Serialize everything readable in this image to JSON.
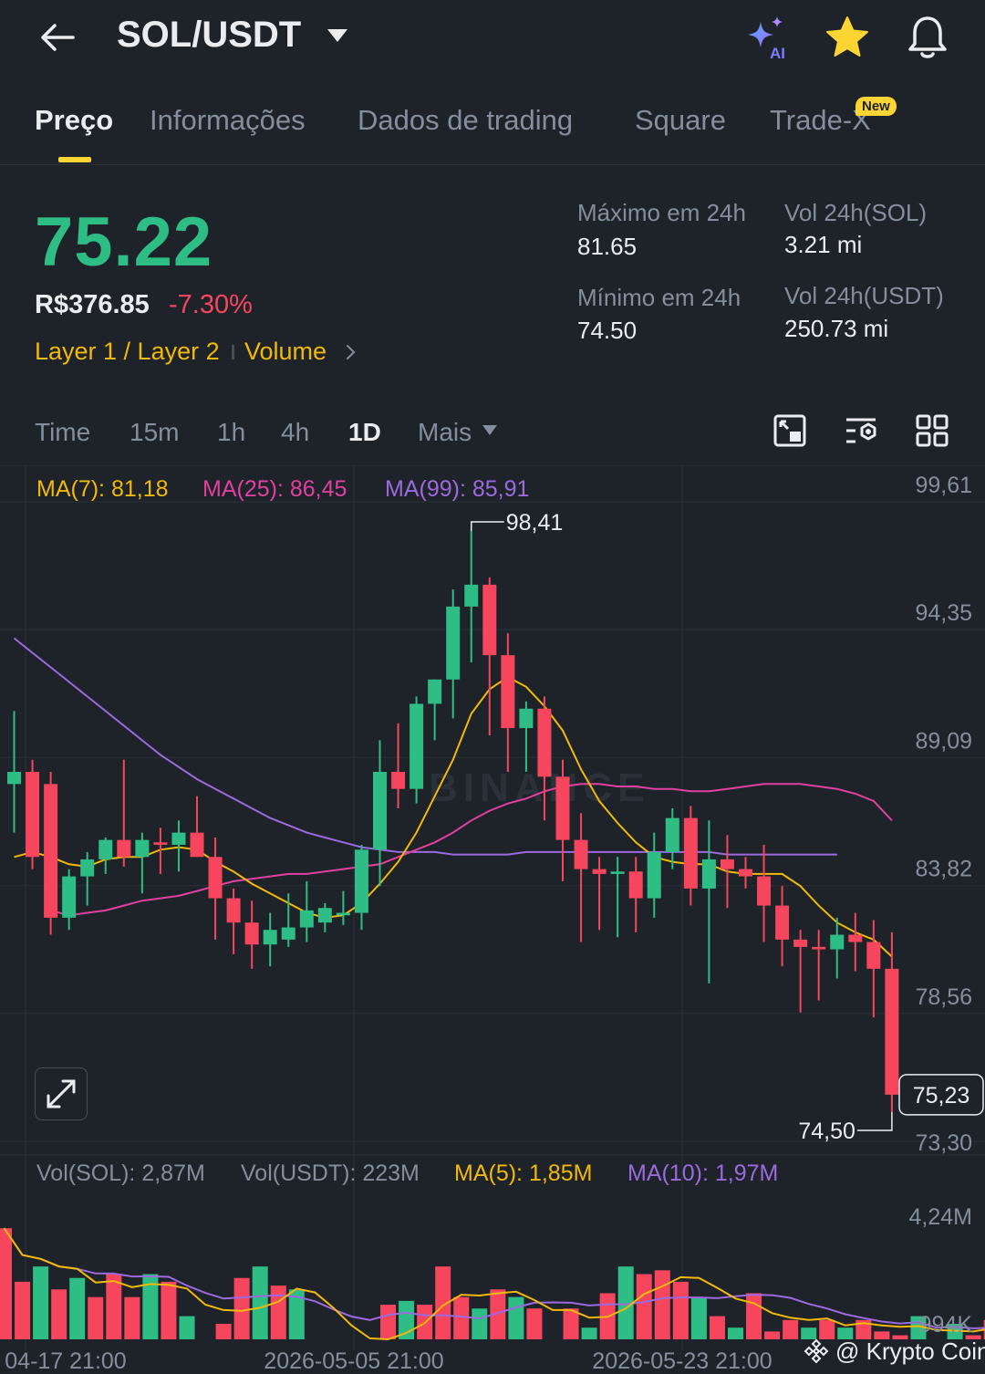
{
  "header": {
    "pair": "SOL/USDT",
    "ai_label": "AI"
  },
  "tabs": [
    {
      "label": "Preço",
      "active": true
    },
    {
      "label": "Informações"
    },
    {
      "label": "Dados de trading"
    },
    {
      "label": "Square"
    },
    {
      "label": "Trade-X",
      "badge": "New"
    }
  ],
  "ticker": {
    "last_price": "75.22",
    "fiat_price": "R$376.85",
    "change": "-7.30%",
    "tag1": "Layer 1 / Layer 2",
    "tag2": "Volume",
    "high_label": "Máximo em 24h",
    "high_value": "81.65",
    "low_label": "Mínimo em 24h",
    "low_value": "74.50",
    "vol_base_label": "Vol 24h(SOL)",
    "vol_base_value": "3.21 mi",
    "vol_quote_label": "Vol 24h(USDT)",
    "vol_quote_value": "250.73 mi"
  },
  "timeframes": [
    {
      "label": "Time"
    },
    {
      "label": "15m"
    },
    {
      "label": "1h"
    },
    {
      "label": "4h"
    },
    {
      "label": "1D",
      "active": true
    },
    {
      "label": "Mais"
    }
  ],
  "colors": {
    "up": "#2ebd85",
    "down": "#f6465d",
    "ma7": "#f0b90b",
    "ma25": "#e040a0",
    "ma99": "#9c6ade",
    "accent": "#fcd535"
  },
  "chart_data": {
    "type": "candlestick",
    "interval": "1D",
    "ma_legend": {
      "ma7": "MA(7): 81,18",
      "ma25": "MA(25): 86,45",
      "ma99": "MA(99): 85,91"
    },
    "y_ticks": [
      "99,61",
      "94,35",
      "89,09",
      "83,82",
      "78,56",
      "73,30"
    ],
    "ylim": [
      73.3,
      99.61
    ],
    "x_ticks": [
      "04-17 21:00",
      "2026-05-05 21:00",
      "2026-05-23 21:00"
    ],
    "high_marker": "98,41",
    "low_marker": "74,50",
    "current_price": "75,23",
    "candles": [
      {
        "o": 88.0,
        "h": 91.0,
        "l": 86.0,
        "c": 88.5
      },
      {
        "o": 88.5,
        "h": 89.0,
        "l": 84.5,
        "c": 85.0
      },
      {
        "o": 88.0,
        "h": 88.5,
        "l": 81.8,
        "c": 82.5
      },
      {
        "o": 82.5,
        "h": 84.5,
        "l": 82.0,
        "c": 84.2
      },
      {
        "o": 84.2,
        "h": 85.2,
        "l": 83.0,
        "c": 84.9
      },
      {
        "o": 84.9,
        "h": 85.8,
        "l": 84.3,
        "c": 85.7
      },
      {
        "o": 85.7,
        "h": 89.0,
        "l": 84.6,
        "c": 85.0
      },
      {
        "o": 85.0,
        "h": 86.0,
        "l": 83.5,
        "c": 85.7
      },
      {
        "o": 85.6,
        "h": 86.2,
        "l": 84.3,
        "c": 85.5
      },
      {
        "o": 85.5,
        "h": 86.5,
        "l": 84.4,
        "c": 86.0
      },
      {
        "o": 86.0,
        "h": 87.5,
        "l": 85.0,
        "c": 85.0
      },
      {
        "o": 85.0,
        "h": 85.8,
        "l": 81.6,
        "c": 83.3
      },
      {
        "o": 83.3,
        "h": 83.7,
        "l": 81.0,
        "c": 82.3
      },
      {
        "o": 82.3,
        "h": 83.2,
        "l": 80.4,
        "c": 81.4
      },
      {
        "o": 81.4,
        "h": 82.7,
        "l": 80.5,
        "c": 82.0
      },
      {
        "o": 81.6,
        "h": 83.5,
        "l": 81.3,
        "c": 82.1
      },
      {
        "o": 82.1,
        "h": 84.0,
        "l": 81.5,
        "c": 82.8
      },
      {
        "o": 82.3,
        "h": 83.1,
        "l": 81.9,
        "c": 82.9
      },
      {
        "o": 82.6,
        "h": 83.6,
        "l": 82.2,
        "c": 82.7
      },
      {
        "o": 82.7,
        "h": 85.5,
        "l": 82.0,
        "c": 85.3
      },
      {
        "o": 85.3,
        "h": 89.8,
        "l": 83.8,
        "c": 88.5
      },
      {
        "o": 88.5,
        "h": 90.5,
        "l": 87.0,
        "c": 87.8
      },
      {
        "o": 87.8,
        "h": 91.6,
        "l": 87.2,
        "c": 91.3
      },
      {
        "o": 91.3,
        "h": 92.3,
        "l": 89.8,
        "c": 92.3
      },
      {
        "o": 92.3,
        "h": 96.0,
        "l": 90.7,
        "c": 95.3
      },
      {
        "o": 95.3,
        "h": 98.41,
        "l": 93.0,
        "c": 96.2
      },
      {
        "o": 96.2,
        "h": 96.5,
        "l": 90.0,
        "c": 93.3
      },
      {
        "o": 93.3,
        "h": 94.2,
        "l": 88.5,
        "c": 90.3
      },
      {
        "o": 90.3,
        "h": 91.4,
        "l": 88.5,
        "c": 91.1
      },
      {
        "o": 91.1,
        "h": 91.6,
        "l": 86.5,
        "c": 88.3
      },
      {
        "o": 88.3,
        "h": 89.0,
        "l": 84.0,
        "c": 85.7
      },
      {
        "o": 85.7,
        "h": 86.8,
        "l": 81.5,
        "c": 84.5
      },
      {
        "o": 84.5,
        "h": 85.0,
        "l": 82.0,
        "c": 84.3
      },
      {
        "o": 84.3,
        "h": 85.0,
        "l": 81.7,
        "c": 84.4
      },
      {
        "o": 84.4,
        "h": 85.0,
        "l": 81.9,
        "c": 83.3
      },
      {
        "o": 83.3,
        "h": 86.0,
        "l": 82.5,
        "c": 85.2
      },
      {
        "o": 85.2,
        "h": 87.0,
        "l": 84.5,
        "c": 86.6
      },
      {
        "o": 86.6,
        "h": 87.1,
        "l": 83.0,
        "c": 83.7
      },
      {
        "o": 83.7,
        "h": 86.5,
        "l": 79.8,
        "c": 84.9
      },
      {
        "o": 84.9,
        "h": 85.9,
        "l": 82.9,
        "c": 84.5
      },
      {
        "o": 84.5,
        "h": 85.0,
        "l": 83.7,
        "c": 84.2
      },
      {
        "o": 84.2,
        "h": 85.5,
        "l": 81.5,
        "c": 83.0
      },
      {
        "o": 83.0,
        "h": 83.8,
        "l": 80.5,
        "c": 81.6
      },
      {
        "o": 81.6,
        "h": 82.0,
        "l": 78.6,
        "c": 81.3
      },
      {
        "o": 81.3,
        "h": 82.0,
        "l": 79.1,
        "c": 81.2
      },
      {
        "o": 81.2,
        "h": 82.5,
        "l": 80.0,
        "c": 81.8
      },
      {
        "o": 81.8,
        "h": 82.7,
        "l": 80.3,
        "c": 81.5
      },
      {
        "o": 81.5,
        "h": 82.4,
        "l": 78.4,
        "c": 80.4
      },
      {
        "o": 80.4,
        "h": 81.9,
        "l": 74.5,
        "c": 75.22
      }
    ],
    "ma7": [
      85.0,
      85.2,
      85.0,
      84.7,
      84.6,
      84.9,
      85.0,
      85.0,
      85.3,
      85.4,
      85.3,
      84.8,
      84.4,
      83.9,
      83.5,
      83.1,
      82.7,
      82.5,
      82.6,
      83.1,
      83.9,
      84.8,
      86.0,
      87.5,
      89.0,
      90.9,
      91.9,
      92.4,
      92.0,
      91.2,
      90.2,
      88.6,
      87.3,
      86.4,
      85.6,
      85.0,
      84.8,
      84.7,
      84.7,
      84.4,
      84.3,
      84.3,
      84.3,
      83.8,
      83.0,
      82.3,
      81.9,
      81.6,
      80.9
    ],
    "ma25": [
      82.8,
      82.6,
      82.7,
      82.8,
      83.0,
      83.2,
      83.3,
      83.4,
      83.6,
      83.8,
      84.0,
      84.1,
      84.2,
      84.3,
      84.3,
      84.4,
      84.5,
      84.6,
      84.7,
      85.0,
      85.3,
      85.6,
      86.0,
      86.5,
      86.9,
      87.2,
      87.4,
      87.7,
      87.9,
      88.0,
      88.0,
      87.9,
      87.9,
      87.8,
      87.8,
      87.7,
      87.7,
      87.8,
      87.9,
      88.0,
      88.0,
      88.0,
      87.9,
      87.8,
      87.6,
      87.3,
      86.5
    ],
    "ma99": [
      94.0,
      93.4,
      92.8,
      92.2,
      91.6,
      91.0,
      90.4,
      89.8,
      89.2,
      88.7,
      88.2,
      87.8,
      87.4,
      87.0,
      86.6,
      86.3,
      86.0,
      85.8,
      85.6,
      85.4,
      85.3,
      85.2,
      85.2,
      85.2,
      85.1,
      85.1,
      85.1,
      85.1,
      85.2,
      85.2,
      85.2,
      85.2,
      85.2,
      85.2,
      85.2,
      85.2,
      85.2,
      85.2,
      85.2,
      85.1,
      85.1,
      85.1,
      85.1,
      85.1,
      85.1,
      85.1
    ],
    "volume": {
      "legend": {
        "vol_base": "Vol(SOL): 2,87M",
        "vol_quote": "Vol(USDT): 223M",
        "ma5": "MA(5): 1,85M",
        "ma10": "MA(10): 1,97M"
      },
      "y_ticks": [
        "4,24M",
        "994K"
      ],
      "ylim": [
        0.994,
        4.24
      ],
      "values": [
        3.9,
        2.5,
        2.9,
        2.3,
        2.6,
        2.1,
        2.7,
        2.1,
        2.7,
        2.5,
        1.6,
        0.6,
        1.4,
        2.6,
        2.9,
        2.4,
        2.3,
        0.9,
        0.6,
        0.6,
        0.7,
        1.9,
        2.0,
        1.9,
        2.9,
        2.1,
        1.8,
        2.3,
        2.1,
        1.8,
        0.8,
        1.8,
        1.3,
        2.2,
        2.9,
        2.7,
        2.8,
        2.5,
        2.1,
        1.6,
        1.3,
        2.2,
        1.2,
        1.5,
        1.3,
        1.5,
        1.3,
        1.5,
        1.2,
        1.1,
        1.6,
        0.8,
        1.4,
        1.1,
        1.5,
        0.8,
        1.1,
        1.5,
        0.9,
        1.3
      ]
    }
  },
  "watermark": "@ Krypto Coin"
}
